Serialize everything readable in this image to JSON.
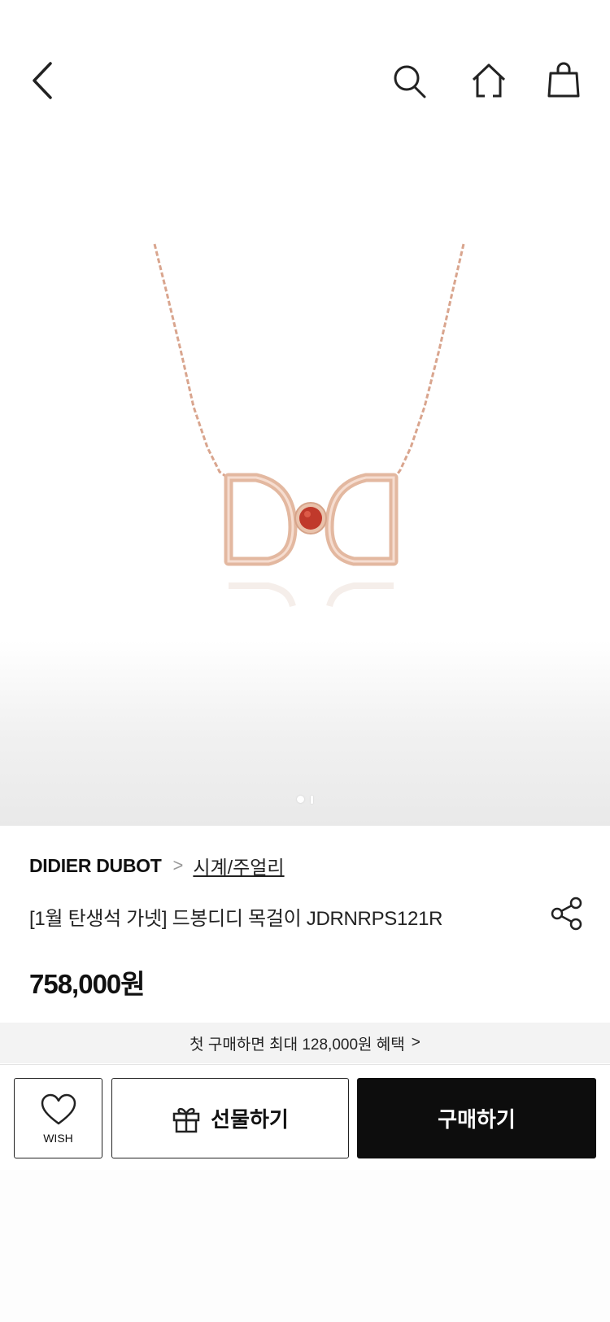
{
  "header": {
    "back_icon": "back-arrow-icon",
    "search_icon": "search-icon",
    "home_icon": "home-icon",
    "bag_icon": "shopping-bag-icon"
  },
  "gallery": {
    "image": "rose gold DD necklace with red garnet",
    "active_index": 0,
    "count": 2
  },
  "product": {
    "brand": "DIDIER DUBOT",
    "breadcrumb_sep": ">",
    "category": "시계/주얼리",
    "title": "[1월 탄생석 가넷] 드봉디디 목걸이 JDRNRPS121R",
    "price": "758,000원"
  },
  "benefit": {
    "text": "첫 구매하면 최대 128,000원 혜택",
    "chevron": ">"
  },
  "actions": {
    "wish_label": "WISH",
    "gift_label": "선물하기",
    "buy_label": "구매하기"
  },
  "colors": {
    "primary": "#0d0d0d",
    "benefit_bg": "#f3f3f3",
    "rose_gold": "#e2b49a",
    "garnet": "#c0392b"
  }
}
